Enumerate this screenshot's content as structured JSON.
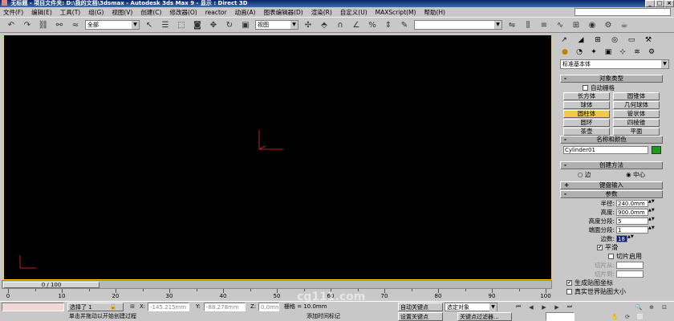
{
  "window": {
    "title": "无标题  - 项目文件夹: D:\\我的文档\\3dsmax   - Autodesk 3ds Max 9    - 显示 : Direct 3D"
  },
  "menus": [
    "文件(F)",
    "编辑(E)",
    "工具(T)",
    "组(G)",
    "视图(V)",
    "创建(C)",
    "修改器(O)",
    "reactor",
    "动画(A)",
    "图表编辑器(D)",
    "渲染(R)",
    "自定义(U)",
    "MAXScript(M)",
    "帮助(H)"
  ],
  "toolbar": {
    "selection_filter": "全部",
    "ref_coord": "视图"
  },
  "command_panel": {
    "category": "标准基本体",
    "object_type": {
      "title": "对象类型",
      "autogrid_label": "自动栅格",
      "buttons": [
        "长方体",
        "圆锥体",
        "球体",
        "几何球体",
        "圆柱体",
        "管状体",
        "圆环",
        "四棱锥",
        "茶壶",
        "平面"
      ],
      "active_button": "圆柱体"
    },
    "name_color": {
      "title": "名称和颜色",
      "name": "Cylinder01",
      "color": "#1a9b1a"
    },
    "creation_method": {
      "title": "创建方法",
      "options": [
        "边",
        "中心"
      ],
      "selected": "中心"
    },
    "keyboard_entry": {
      "title": "键盘输入"
    },
    "parameters": {
      "title": "参数",
      "radius_label": "半径:",
      "radius": "240.0mm",
      "height_label": "高度:",
      "height": "900.0mm",
      "height_segs_label": "高度分段:",
      "height_segs": "5",
      "cap_segs_label": "端面分段:",
      "cap_segs": "1",
      "sides_label": "边数:",
      "sides": "18",
      "smooth_label": "平滑",
      "slice_on_label": "切片启用",
      "slice_from_label": "切片从:",
      "slice_to_label": "切片到:",
      "gen_map_label": "生成贴图坐标",
      "real_world_label": "真实世界贴图大小"
    }
  },
  "timeline": {
    "position": "0 / 100",
    "ticks": [
      0,
      10,
      20,
      30,
      40,
      50,
      60,
      70,
      80,
      90,
      100
    ]
  },
  "status": {
    "selected": "选择了 1",
    "x_label": "X:",
    "x": "-145.215mm",
    "y_label": "Y:",
    "y": "-88.278mm",
    "z_label": "Z:",
    "z": "0.0mm",
    "grid": "栅格 = 10.0mm",
    "auto_key": "自动关键点",
    "selected_objects": "选定对象",
    "prompt": "单击并拖动以开始创建过程",
    "add_time_tag": "添加时间标记",
    "set_key": "设置关键点",
    "key_filters": "关键点过滤器..."
  },
  "watermark": "cg111.com"
}
